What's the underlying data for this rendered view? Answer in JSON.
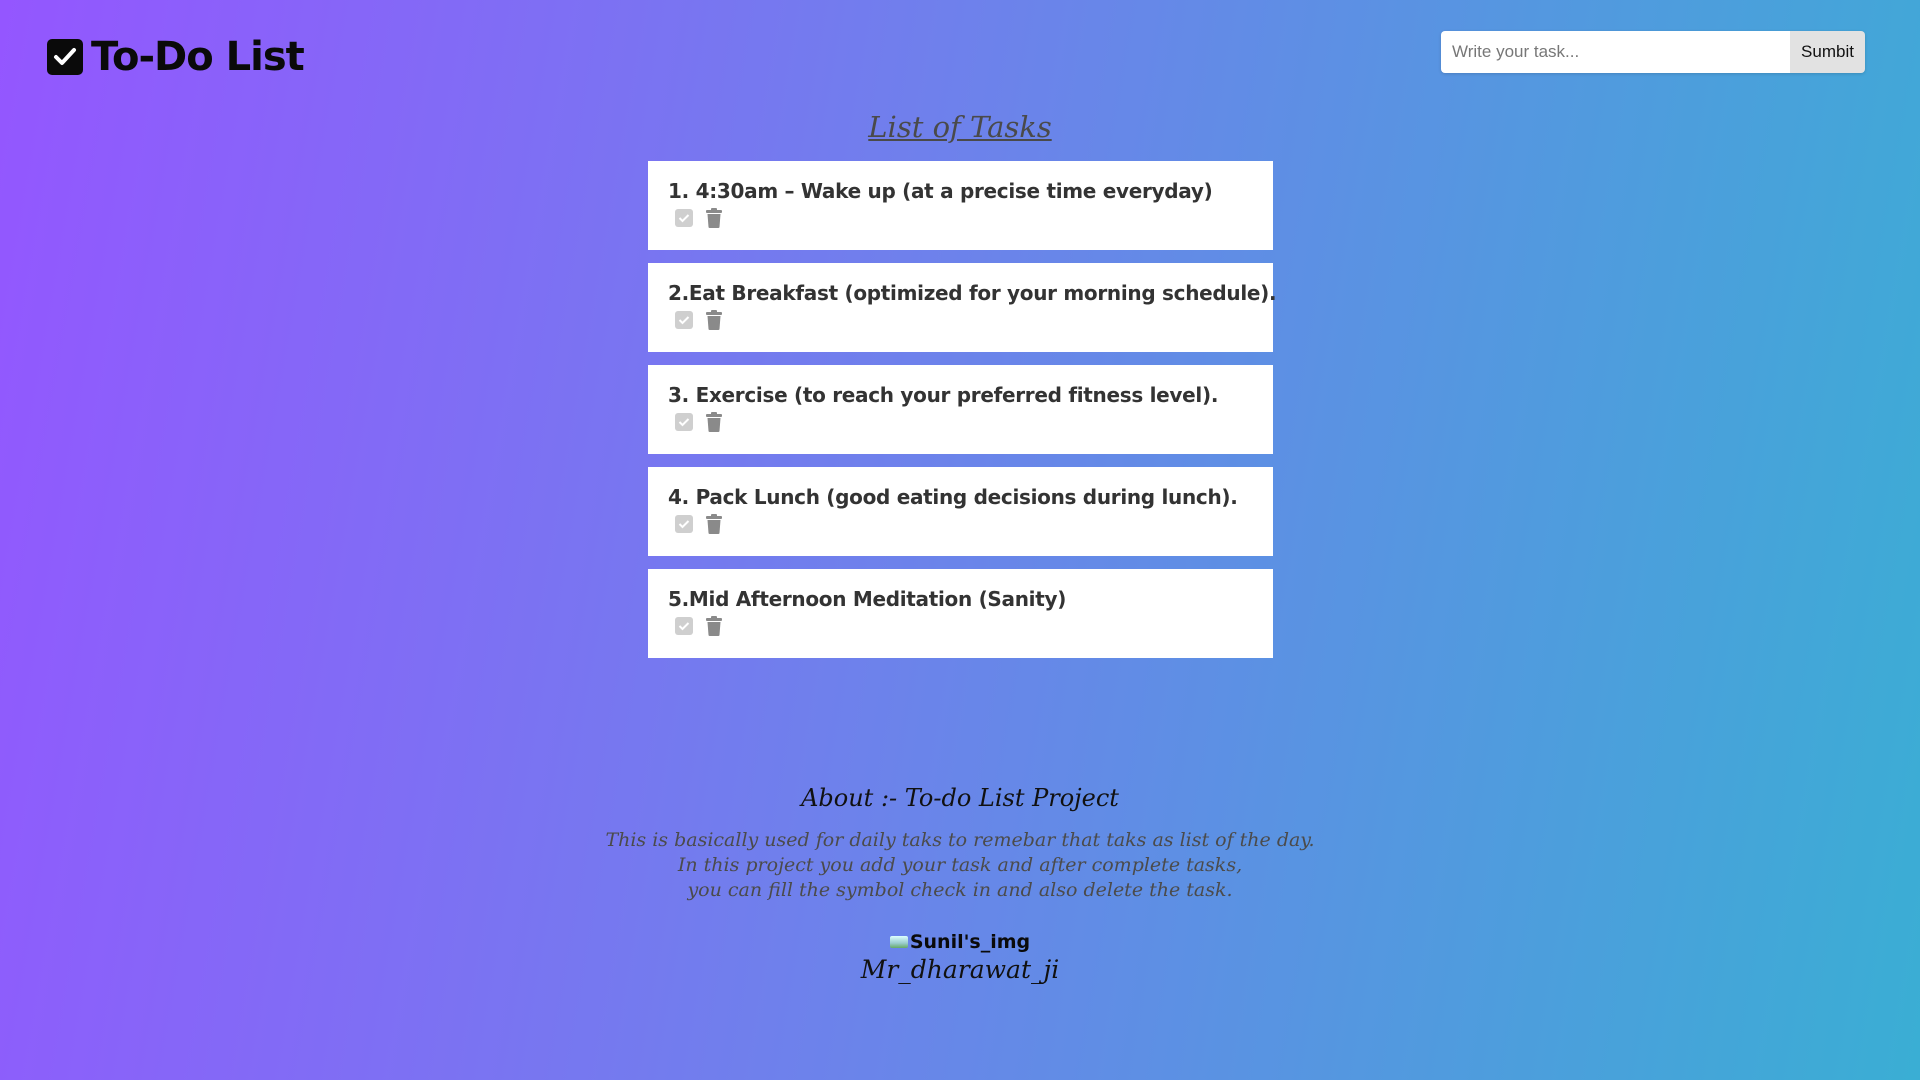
{
  "header": {
    "title": "To-Do List",
    "icon": "checkbox-icon"
  },
  "search": {
    "placeholder": "Write your task...",
    "value": "",
    "submit_label": "Sumbit"
  },
  "tasks_section": {
    "title": "List of Tasks",
    "items": [
      {
        "text": "1. 4:30am – Wake up (at a precise time everyday)"
      },
      {
        "text": "2.Eat Breakfast (optimized for your morning schedule)."
      },
      {
        "text": "3. Exercise (to reach your preferred fitness level)."
      },
      {
        "text": "4. Pack Lunch (good eating decisions during lunch)."
      },
      {
        "text": "5.Mid Afternoon Meditation (Sanity)"
      }
    ],
    "item_icons": [
      "check-icon",
      "trash-icon"
    ]
  },
  "about": {
    "title": "About :- To-do List Project",
    "lines": [
      "This is basically used for daily taks to remebar that taks as list of the day.",
      "In this project you add your task and after complete tasks,",
      "you can fill the symbol check in and also delete the task."
    ],
    "image_alt": "Sunil's_img",
    "author": "Mr_dharawat_ji"
  },
  "colors": {
    "gradient_start": "#9456ff",
    "gradient_end": "#3aaed4",
    "card": "#ffffff",
    "text": "#333333"
  }
}
